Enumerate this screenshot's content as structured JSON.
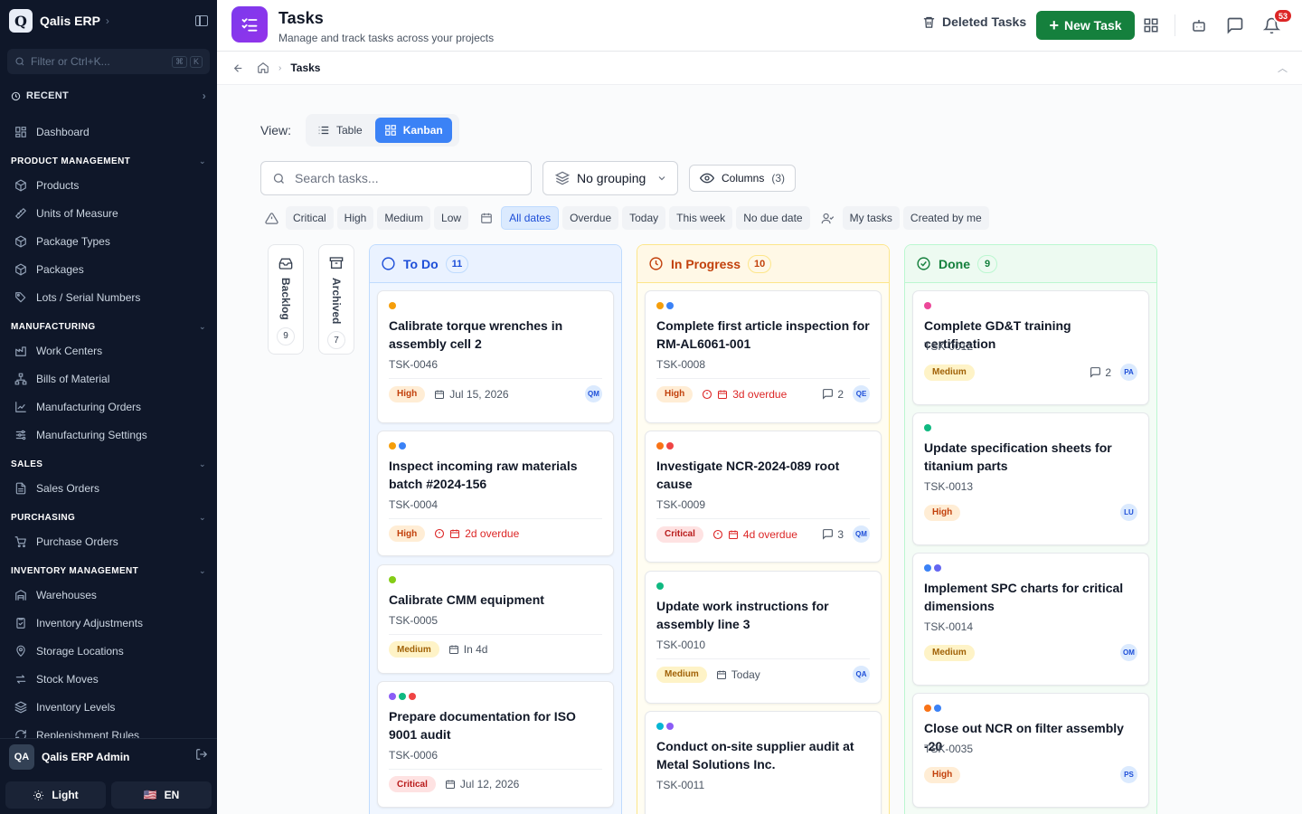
{
  "app": {
    "logo_letter": "Q",
    "name": "Qalis ERP"
  },
  "sidebar": {
    "filter_placeholder": "Filter or Ctrl+K...",
    "kbd": [
      "⌘",
      "K"
    ],
    "recent_label": "RECENT",
    "dashboard": "Dashboard",
    "sections": [
      {
        "title": "PRODUCT MANAGEMENT",
        "items": [
          "Products",
          "Units of Measure",
          "Package Types",
          "Packages",
          "Lots / Serial Numbers"
        ]
      },
      {
        "title": "MANUFACTURING",
        "items": [
          "Work Centers",
          "Bills of Material",
          "Manufacturing Orders",
          "Manufacturing Settings"
        ]
      },
      {
        "title": "SALES",
        "items": [
          "Sales Orders"
        ]
      },
      {
        "title": "PURCHASING",
        "items": [
          "Purchase Orders"
        ]
      },
      {
        "title": "INVENTORY MANAGEMENT",
        "items": [
          "Warehouses",
          "Inventory Adjustments",
          "Storage Locations",
          "Stock Moves",
          "Inventory Levels",
          "Replenishment Rules"
        ]
      }
    ],
    "user": {
      "initials": "QA",
      "name": "Qalis ERP Admin"
    },
    "theme_label": "Light",
    "lang_flag": "🇺🇸",
    "lang_label": "EN"
  },
  "header": {
    "title": "Tasks",
    "subtitle": "Manage and track tasks across your projects",
    "deleted_label": "Deleted Tasks",
    "new_task_label": "New Task",
    "notifications": "53"
  },
  "breadcrumb": {
    "current": "Tasks"
  },
  "view": {
    "label": "View:",
    "table": "Table",
    "kanban": "Kanban"
  },
  "toolbar": {
    "search_placeholder": "Search tasks...",
    "grouping": "No grouping",
    "columns_label": "Columns",
    "columns_count": "(3)"
  },
  "filters": {
    "priority": [
      "Critical",
      "High",
      "Medium",
      "Low"
    ],
    "dates": [
      "All dates",
      "Overdue",
      "Today",
      "This week",
      "No due date"
    ],
    "people": [
      "My tasks",
      "Created by me"
    ]
  },
  "stacks": [
    {
      "label": "Backlog",
      "count": "9"
    },
    {
      "label": "Archived",
      "count": "7"
    }
  ],
  "colors": {
    "todo": "#1d4ed8",
    "inprogress": "#c2410c",
    "done": "#15803d",
    "accent": "#3b82f6",
    "primary_button": "#15803d"
  },
  "columns": [
    {
      "title": "To Do",
      "count": "11",
      "cards": [
        {
          "title": "Calibrate torque wrenches in assembly cell 2",
          "id": "TSK-0046",
          "priority": "High",
          "date": "Jul 15, 2026",
          "overdue": false,
          "avatar": "QM",
          "dots": [
            "#f59e0b"
          ]
        },
        {
          "title": "Inspect incoming raw materials batch #2024-156",
          "id": "TSK-0004",
          "priority": "High",
          "date": "2d overdue",
          "overdue": true,
          "dots": [
            "#f59e0b",
            "#3b82f6"
          ]
        },
        {
          "title": "Calibrate CMM equipment",
          "id": "TSK-0005",
          "priority": "Medium",
          "date": "In 4d",
          "overdue": false,
          "dots": [
            "#84cc16"
          ]
        },
        {
          "title": "Prepare documentation for ISO 9001 audit",
          "id": "TSK-0006",
          "priority": "Critical",
          "date": "Jul 12, 2026",
          "overdue": false,
          "dots": [
            "#8b5cf6",
            "#10b981",
            "#ef4444"
          ]
        }
      ]
    },
    {
      "title": "In Progress",
      "count": "10",
      "cards": [
        {
          "title": "Complete first article inspection for RM-AL6061-001",
          "id": "TSK-0008",
          "priority": "High",
          "date": "3d overdue",
          "overdue": true,
          "comments": "2",
          "avatar": "QE",
          "dots": [
            "#f59e0b",
            "#3b82f6"
          ]
        },
        {
          "title": "Investigate NCR-2024-089 root cause",
          "id": "TSK-0009",
          "priority": "Critical",
          "date": "4d overdue",
          "overdue": true,
          "comments": "3",
          "avatar": "QM",
          "dots": [
            "#f97316",
            "#ef4444"
          ]
        },
        {
          "title": "Update work instructions for assembly line 3",
          "id": "TSK-0010",
          "priority": "Medium",
          "date": "Today",
          "overdue": false,
          "avatar": "QA",
          "dots": [
            "#10b981"
          ]
        },
        {
          "title": "Conduct on-site supplier audit at Metal Solutions Inc.",
          "id": "TSK-0011",
          "priority": "",
          "date": "",
          "dots": [
            "#06b6d4",
            "#8b5cf6"
          ]
        }
      ]
    },
    {
      "title": "Done",
      "count": "9",
      "cards": [
        {
          "title": "Complete GD&T training certification",
          "id": "TSK-0012",
          "priority": "Medium",
          "comments": "2",
          "avatar": "PA",
          "dots": [
            "#ec4899"
          ]
        },
        {
          "title": "Update specification sheets for titanium parts",
          "id": "TSK-0013",
          "priority": "High",
          "avatar": "LU",
          "dots": [
            "#10b981"
          ]
        },
        {
          "title": "Implement SPC charts for critical dimensions",
          "id": "TSK-0014",
          "priority": "Medium",
          "avatar": "OM",
          "dots": [
            "#3b82f6",
            "#6366f1"
          ]
        },
        {
          "title": "Close out NCR on filter assembly -20",
          "id": "TSK-0035",
          "priority": "High",
          "avatar": "PS",
          "dots": [
            "#f97316",
            "#3b82f6"
          ]
        }
      ]
    }
  ]
}
